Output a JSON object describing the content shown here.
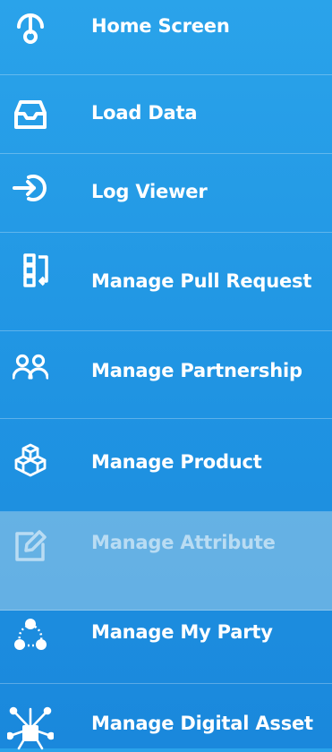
{
  "nav": {
    "items": [
      {
        "label": "Home Screen",
        "icon": "home-icon"
      },
      {
        "label": "Load Data",
        "icon": "inbox-icon"
      },
      {
        "label": "Log Viewer",
        "icon": "login-icon"
      },
      {
        "label": "Manage Pull Request",
        "icon": "pull-request-icon"
      },
      {
        "label": "Manage Partnership",
        "icon": "partners-icon"
      },
      {
        "label": "Manage Product",
        "icon": "boxes-icon"
      },
      {
        "label": "Manage Attribute",
        "icon": "edit-icon",
        "active": true
      },
      {
        "label": "Manage My Party",
        "icon": "party-icon"
      },
      {
        "label": "Manage Digital Asset",
        "icon": "network-icon"
      }
    ]
  },
  "colors": {
    "background": "#2aa3ea",
    "active_background": "#a0cde8",
    "text": "#ffffff"
  }
}
